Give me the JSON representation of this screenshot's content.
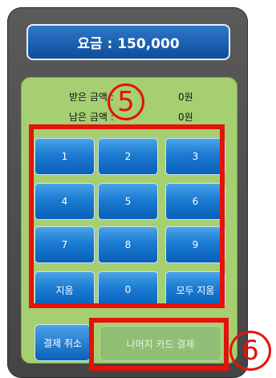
{
  "fee": {
    "text": "요금 : 150,000"
  },
  "info": {
    "received_label": "받은 금액 :",
    "received_value": "0원",
    "remaining_label": "남은 금액 :",
    "remaining_value": "0원"
  },
  "annotations": {
    "step5": "5",
    "step6": "6",
    "marker_color": "#e3120b"
  },
  "keypad": {
    "keys": [
      "1",
      "2",
      "3",
      "4",
      "5",
      "6",
      "7",
      "8",
      "9",
      "지움",
      "0",
      "모두 지움"
    ]
  },
  "actions": {
    "cancel_label": "결제 취소",
    "pay_rest_label": "나머지 카드 결제"
  },
  "colors": {
    "accent": "#1b7bd2",
    "panel_green": "#a6cf72",
    "panel_dark": "#4a4a4a"
  }
}
